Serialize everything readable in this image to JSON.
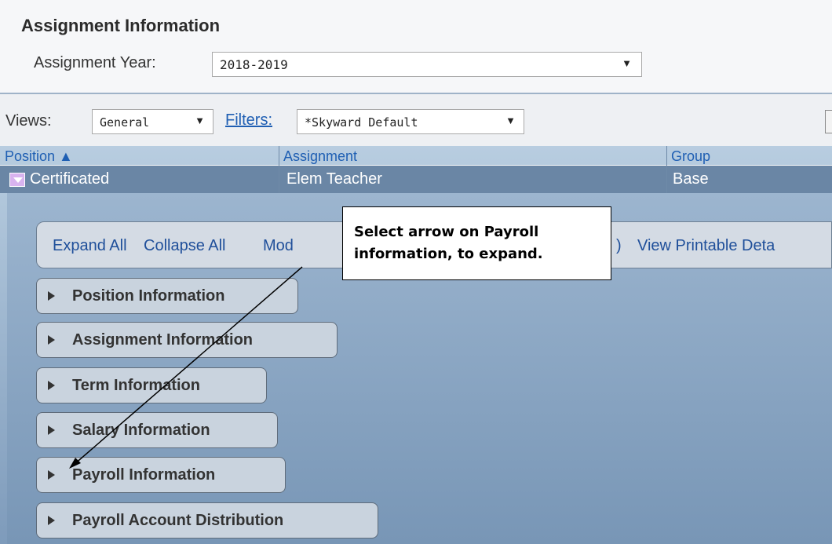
{
  "header": {
    "title": "Assignment Information",
    "year_label": "Assignment Year:",
    "year_value": "2018-2019"
  },
  "toolbar": {
    "views_label": "Views:",
    "views_value": "General",
    "filters_label": "Filters:",
    "filters_value": "*Skyward Default"
  },
  "grid": {
    "columns": [
      "Position ▲",
      "Assignment",
      "Group"
    ],
    "row": {
      "position": "Certificated",
      "assignment": "Elem Teacher",
      "group": "Base"
    }
  },
  "actions": {
    "expand_all": "Expand All",
    "collapse_all": "Collapse All",
    "modify_partial": "Mod",
    "paren_partial": ")",
    "view_printable": "View Printable Deta"
  },
  "sections": [
    "Position Information",
    "Assignment Information",
    "Term Information",
    "Salary Information",
    "Payroll Information",
    "Payroll Account Distribution"
  ],
  "callout": {
    "text": "Select arrow on Payroll information, to expand."
  },
  "colors": {
    "link": "#1f5fb3",
    "grid_row": "#6a86a5",
    "panel": "#8ea9c6"
  },
  "icons": {
    "dropdown": "triangle-down",
    "sort": "triangle-up",
    "section": "triangle-right",
    "expand": "expand-toggle"
  }
}
